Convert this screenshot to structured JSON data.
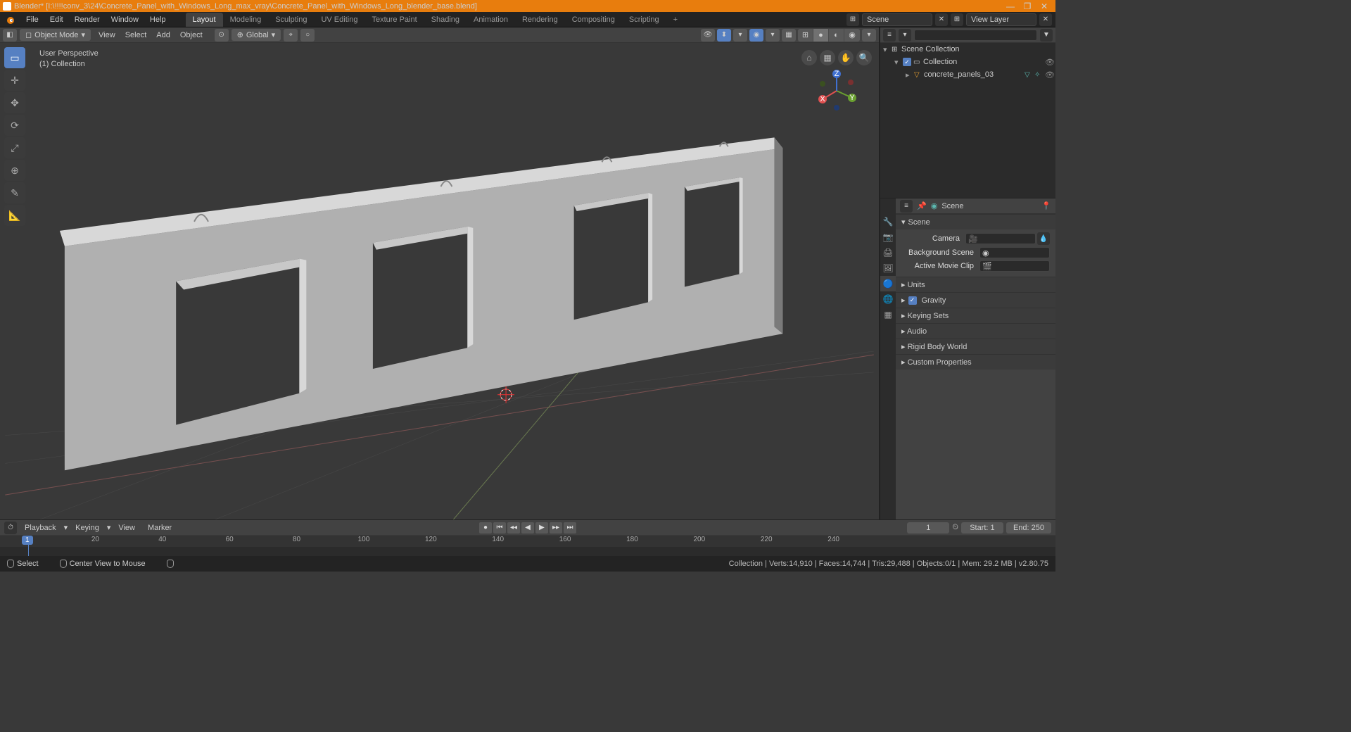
{
  "title": "Blender* [I:\\!!!!conv_3\\24\\Concrete_Panel_with_Windows_Long_max_vray\\Concrete_Panel_with_Windows_Long_blender_base.blend]",
  "menu": {
    "file": "File",
    "edit": "Edit",
    "render": "Render",
    "window": "Window",
    "help": "Help"
  },
  "workspaces": [
    "Layout",
    "Modeling",
    "Sculpting",
    "UV Editing",
    "Texture Paint",
    "Shading",
    "Animation",
    "Rendering",
    "Compositing",
    "Scripting"
  ],
  "active_workspace": "Layout",
  "scene_label": "Scene",
  "viewlayer_label": "View Layer",
  "viewport": {
    "mode": "Object Mode",
    "menus": [
      "View",
      "Select",
      "Add",
      "Object"
    ],
    "orientation": "Global",
    "overlay_line1": "User Perspective",
    "overlay_line2": "(1) Collection"
  },
  "outliner": {
    "root": "Scene Collection",
    "collection": "Collection",
    "object": "concrete_panels_03"
  },
  "properties": {
    "header": "Scene",
    "panel_title": "Scene",
    "camera": "Camera",
    "bg_scene": "Background Scene",
    "movie_clip": "Active Movie Clip",
    "sections": [
      "Units",
      "Gravity",
      "Keying Sets",
      "Audio",
      "Rigid Body World",
      "Custom Properties"
    ]
  },
  "timeline": {
    "playback": "Playback",
    "keying": "Keying",
    "view": "View",
    "marker": "Marker",
    "current": 1,
    "start_label": "Start:",
    "start": 1,
    "end_label": "End:",
    "end": 250,
    "ticks": [
      1,
      20,
      40,
      60,
      80,
      100,
      120,
      140,
      160,
      180,
      200,
      220,
      240
    ]
  },
  "statusbar": {
    "select": "Select",
    "center": "Center View to Mouse",
    "stats": "Collection | Verts:14,910 | Faces:14,744 | Tris:29,488 | Objects:0/1 | Mem: 29.2 MB | v2.80.75"
  }
}
